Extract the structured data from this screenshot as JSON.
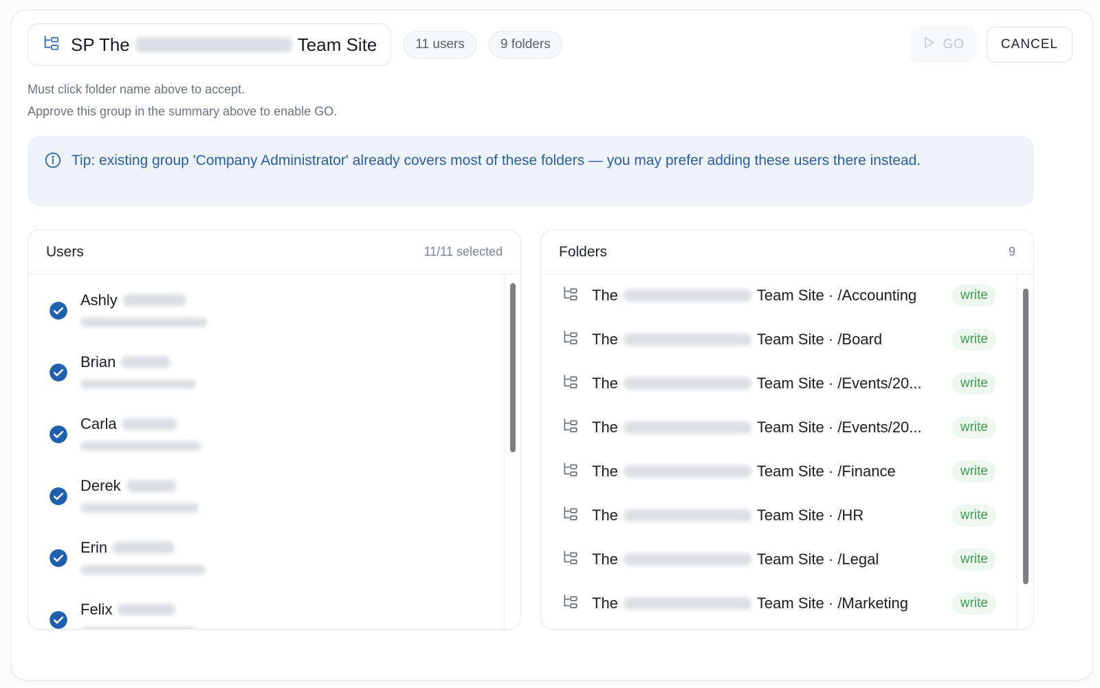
{
  "header": {
    "group_prefix": "SP The",
    "group_suffix": "Team Site",
    "users_pill": "11 users",
    "folders_pill": "9 folders",
    "go_label": "GO",
    "cancel_label": "CANCEL"
  },
  "hints": [
    "Must click folder name above to accept.",
    "Approve this group in the summary above to enable GO."
  ],
  "tip": {
    "text": "Tip: existing group 'Company Administrator' already covers most of these folders — you may prefer adding these users there instead."
  },
  "users_panel": {
    "title": "Users",
    "selected": "11/11 selected",
    "users": [
      {
        "first": "Ashly"
      },
      {
        "first": "Brian"
      },
      {
        "first": "Carla"
      },
      {
        "first": "Derek"
      },
      {
        "first": "Erin"
      },
      {
        "first": "Felix"
      }
    ]
  },
  "folders_panel": {
    "title": "Folders",
    "count": "9",
    "prefix": "The",
    "suffix": "Team Site",
    "folders": [
      {
        "path": "· /Accounting",
        "perm": "write"
      },
      {
        "path": "· /Board",
        "perm": "write"
      },
      {
        "path": "· /Events/20...",
        "perm": "write"
      },
      {
        "path": "· /Events/20...",
        "perm": "write"
      },
      {
        "path": "· /Finance",
        "perm": "write"
      },
      {
        "path": "· /HR",
        "perm": "write"
      },
      {
        "path": "· /Legal",
        "perm": "write"
      },
      {
        "path": "· /Marketing",
        "perm": "write"
      }
    ]
  },
  "colors": {
    "accent_blue": "#1f5fb0",
    "tip_bg": "#eef3f9",
    "write_green": "#3f9b4f"
  },
  "icons": {
    "group": "folder-tree-icon",
    "check": "check-circle-icon",
    "info": "info-icon",
    "play": "play-icon"
  }
}
